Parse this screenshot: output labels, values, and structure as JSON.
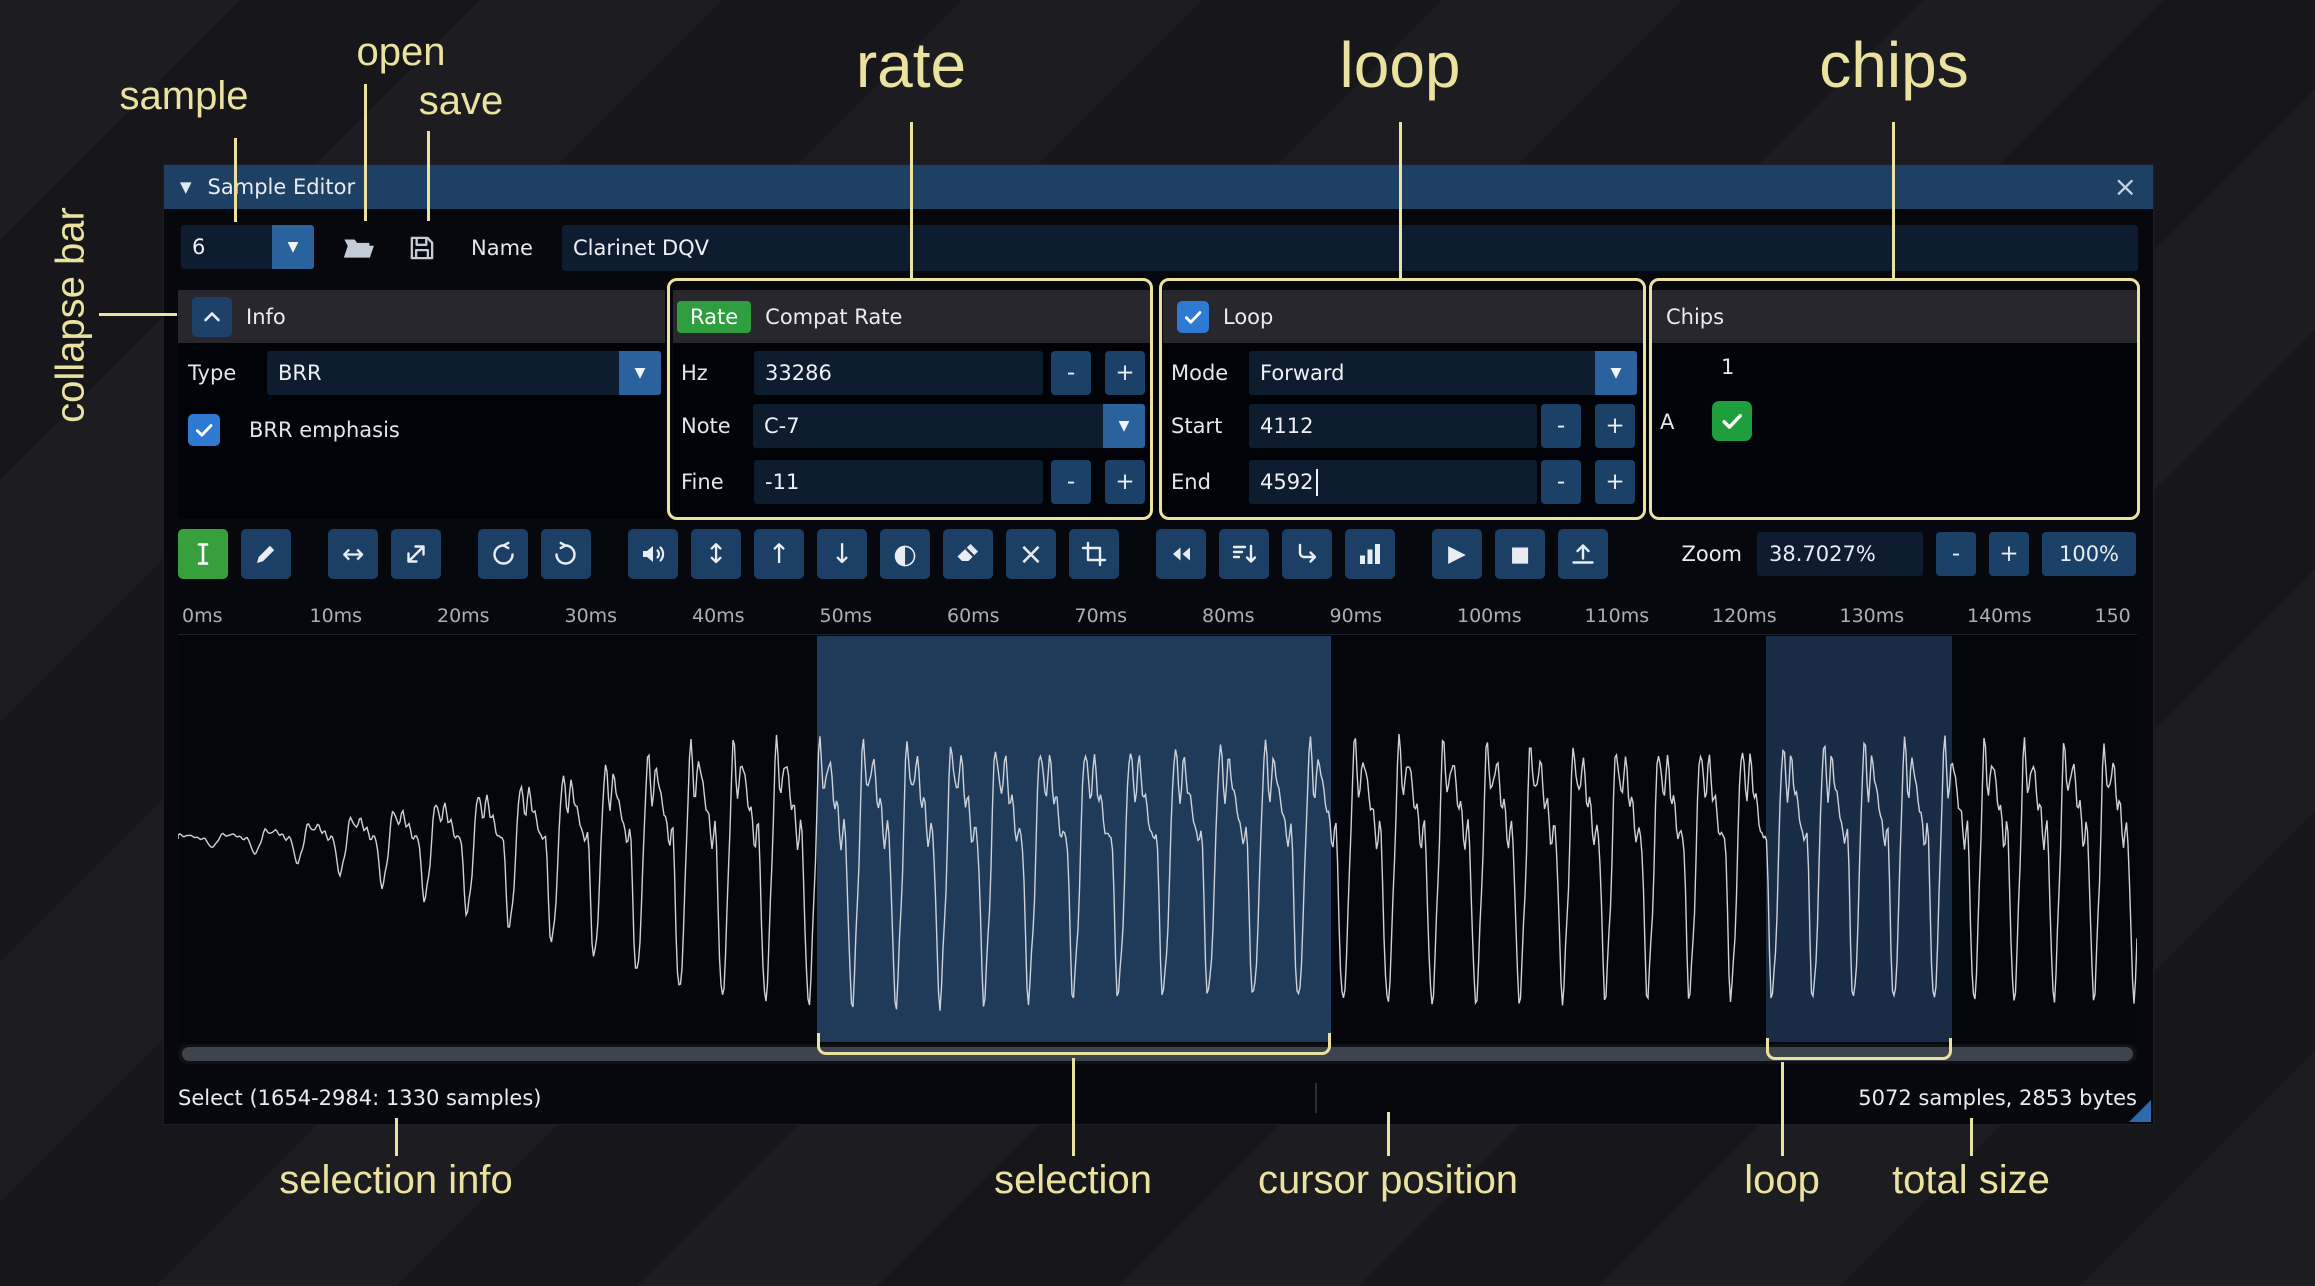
{
  "ui": {
    "minus": "-",
    "plus": "+"
  },
  "glyphs": {
    "window_collapse": "▼",
    "close": "×",
    "dropdown_arrow": "▼",
    "resize_h": "↔",
    "resize_v": "↕",
    "arrow_up": "↑",
    "arrow_down": "↓",
    "invert": "◐",
    "silence": "×",
    "play": "▶",
    "stop": "■"
  },
  "annotations": {
    "sample": "sample",
    "open": "open",
    "save": "save",
    "rate": "rate",
    "loop": "loop",
    "chips": "chips",
    "collapse_bar": "collapse bar",
    "selection_info": "selection info",
    "selection": "selection",
    "cursor_position": "cursor position",
    "loop_points": "loop",
    "total_size": "total size"
  },
  "window": {
    "title": "Sample Editor",
    "sample_index": "6",
    "name_label": "Name",
    "name_value": "Clarinet DQV"
  },
  "info": {
    "header": "Info",
    "type_label": "Type",
    "type_value": "BRR",
    "emphasis_label": "BRR emphasis"
  },
  "rate": {
    "badge": "Rate",
    "title": "Compat Rate",
    "hz_label": "Hz",
    "hz_value": "33286",
    "note_label": "Note",
    "note_value": "C-7",
    "fine_label": "Fine",
    "fine_value": "-11"
  },
  "loop": {
    "label": "Loop",
    "mode_label": "Mode",
    "mode_value": "Forward",
    "start_label": "Start",
    "start_value": "4112",
    "end_label": "End",
    "end_value": "4592"
  },
  "chips": {
    "header": "Chips",
    "column": "1",
    "row": "A"
  },
  "toolbar": {
    "zoom_label": "Zoom",
    "zoom_value": "38.7027%",
    "zoom_reset": "100%",
    "icons": [
      "ibeam-cursor",
      "pencil",
      "arrows-horizontal",
      "arrows-diagonal",
      "undo",
      "redo",
      "speaker",
      "arrows-vertical",
      "arrow-up",
      "arrow-down",
      "half-circle",
      "eraser",
      "cross",
      "crop",
      "rewind",
      "sort-lines",
      "corner-arrow",
      "bar-chart",
      "play",
      "stop",
      "upload"
    ]
  },
  "ruler": {
    "labels": [
      "0ms",
      "10ms",
      "20ms",
      "30ms",
      "40ms",
      "50ms",
      "60ms",
      "70ms",
      "80ms",
      "90ms",
      "100ms",
      "110ms",
      "120ms",
      "130ms",
      "140ms",
      "150"
    ]
  },
  "status": {
    "selection_info": "Select (1654-2984: 1330 samples)",
    "total_size": "5072 samples, 2853 bytes"
  },
  "waveform": {
    "total_samples": 5072,
    "selection_start": 1654,
    "selection_end": 2984,
    "loop_start": 4112,
    "loop_end": 4592
  }
}
